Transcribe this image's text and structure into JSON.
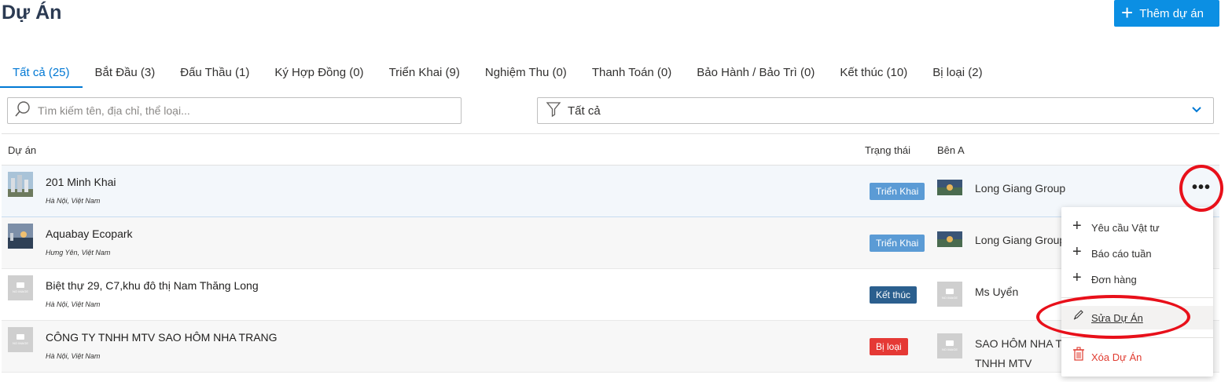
{
  "header": {
    "title": "Dự Án",
    "add_button": "Thêm dự án"
  },
  "tabs": [
    {
      "label": "Tất cả (25)",
      "active": true
    },
    {
      "label": "Bắt Đầu (3)"
    },
    {
      "label": "Đấu Thầu (1)"
    },
    {
      "label": "Ký Hợp Đồng (0)"
    },
    {
      "label": "Triển Khai (9)"
    },
    {
      "label": "Nghiệm Thu (0)"
    },
    {
      "label": "Thanh Toán (0)"
    },
    {
      "label": "Bảo Hành / Bảo Trì (0)"
    },
    {
      "label": "Kết thúc (10)"
    },
    {
      "label": "Bị loại (2)"
    }
  ],
  "search": {
    "placeholder": "Tìm kiếm tên, địa chỉ, thể loại..."
  },
  "filter": {
    "value": "Tất cả"
  },
  "table": {
    "columns": {
      "project": "Dự án",
      "status": "Trạng thái",
      "party_a": "Bên A"
    },
    "rows": [
      {
        "name": "201 Minh Khai",
        "address": "Hà Nội, Việt Nam",
        "status": "Triển Khai",
        "party": "Long Giang Group"
      },
      {
        "name": "Aquabay Ecopark",
        "address": "Hưng Yên, Việt Nam",
        "status": "Triển Khai",
        "party": "Long Giang Group"
      },
      {
        "name": "Biệt thự 29, C7,khu đô thị Nam Thăng Long",
        "address": "Hà Nội, Việt Nam",
        "status": "Kết thúc",
        "party": "Ms Uyển"
      },
      {
        "name": "CÔNG TY TNHH MTV SAO HÔM NHA TRANG",
        "address": "Hà Nội, Việt Nam",
        "status": "Bị loại",
        "party": "SAO HÔM NHA T",
        "party_line2": "TNHH MTV"
      }
    ]
  },
  "no_image_label": "NO IMAGE",
  "context_menu": {
    "items": [
      "Yêu cầu Vật tư",
      "Báo cáo tuần",
      "Đơn hàng"
    ],
    "edit": "Sửa Dự Án",
    "delete": "Xóa Dự Án"
  },
  "colors": {
    "accent": "#0078d4",
    "button": "#0b8fe3",
    "status_active": "#5b9bd5",
    "status_done": "#2b5f8e",
    "status_rejected": "#e53935",
    "annotation": "#e8101a"
  }
}
